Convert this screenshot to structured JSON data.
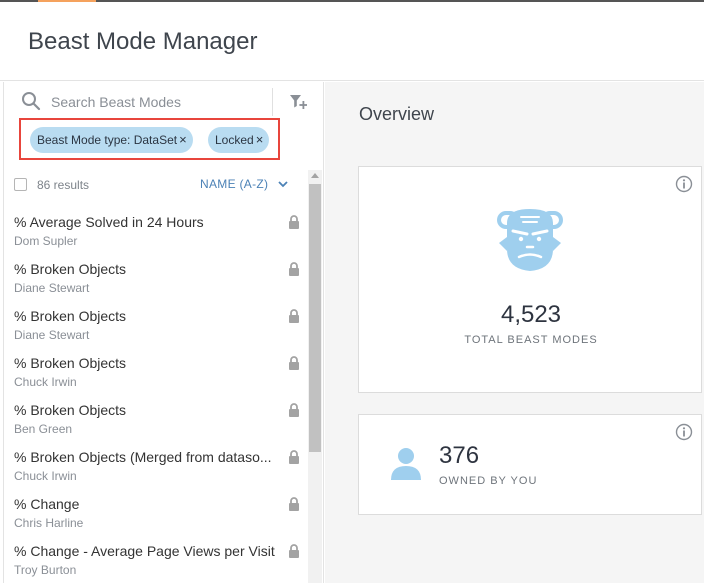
{
  "app": {
    "title": "Beast Mode Manager"
  },
  "search": {
    "placeholder": "Search Beast Modes",
    "value": ""
  },
  "filters": [
    {
      "label": "Beast Mode type: DataSet",
      "remove": "×"
    },
    {
      "label": "Locked",
      "remove": "×"
    }
  ],
  "results": {
    "count_label": "86 results",
    "sort_label": "NAME (A-Z)"
  },
  "list": [
    {
      "title": "% Average Solved in 24 Hours",
      "owner": "Dom Supler",
      "icon": "lock-icon"
    },
    {
      "title": "% Broken Objects",
      "owner": "Diane Stewart",
      "icon": "lock-icon"
    },
    {
      "title": "% Broken Objects",
      "owner": "Diane Stewart",
      "icon": "lock-icon"
    },
    {
      "title": "% Broken Objects",
      "owner": "Chuck Irwin",
      "icon": "lock-icon"
    },
    {
      "title": "% Broken Objects",
      "owner": "Ben Green",
      "icon": "lock-icon"
    },
    {
      "title": "% Broken Objects (Merged from dataso...",
      "owner": "Chuck Irwin",
      "icon": "lock-icon"
    },
    {
      "title": "% Change",
      "owner": "Chris Harline",
      "icon": "lock-icon"
    },
    {
      "title": "% Change - Average Page Views per Visit",
      "owner": "Troy Burton",
      "icon": "lock-icon"
    }
  ],
  "overview": {
    "title": "Overview",
    "total": {
      "value": "4,523",
      "label": "TOTAL BEAST MODES"
    },
    "owned": {
      "value": "376",
      "label": "OWNED BY YOU"
    }
  },
  "colors": {
    "accent": "#f5a25d",
    "pill_bg": "#b9dcf1",
    "highlight_border": "#e8453c",
    "link": "#4c82b6",
    "icon_blue": "#9fcfee"
  }
}
